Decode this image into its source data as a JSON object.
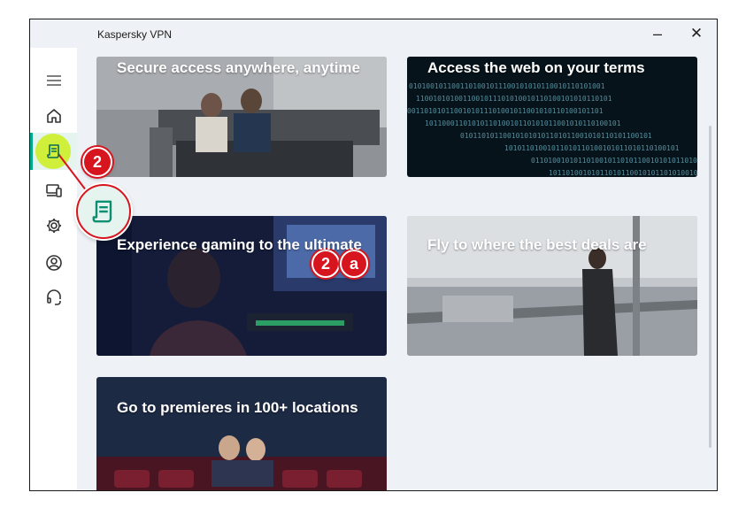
{
  "window": {
    "title": "Kaspersky VPN",
    "minimize_glyph": "–",
    "close_glyph": "✕"
  },
  "sidebar": {
    "items": [
      {
        "name": "menu-icon"
      },
      {
        "name": "home-icon"
      },
      {
        "name": "scenarios-icon",
        "active": true
      },
      {
        "name": "devices-icon"
      },
      {
        "name": "settings-icon"
      },
      {
        "name": "account-icon"
      },
      {
        "name": "support-icon"
      }
    ]
  },
  "cards": [
    {
      "title": "Secure access anywhere, anytime"
    },
    {
      "title": "Access the web on your terms"
    },
    {
      "title": "Experience gaming to the ultimate"
    },
    {
      "title": "Fly to where the best deals are"
    },
    {
      "title": "Go to premieres in 100+ locations"
    }
  ],
  "callouts": {
    "sidebar_badge": "2",
    "card_badge_number": "2",
    "card_badge_letter": "a"
  },
  "colors": {
    "accent": "#00a88e",
    "highlight": "#cfef3a",
    "callout_red": "#d7151f"
  }
}
